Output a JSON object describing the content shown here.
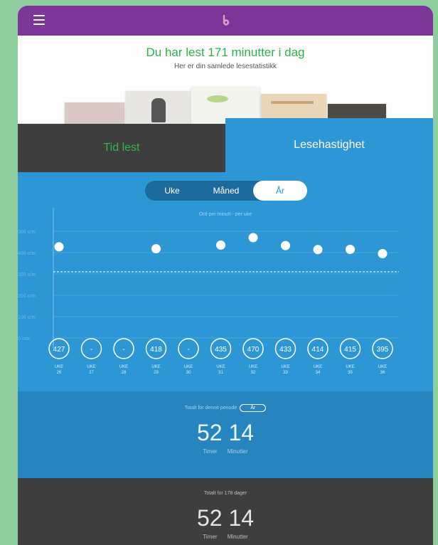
{
  "header": {
    "menu_icon": "hamburger-icon",
    "logo_icon": "bookbites-logo-icon"
  },
  "hero": {
    "title": "Du har lest 171 minutter i dag",
    "subtitle": "Her er din samlede lesestatistikk"
  },
  "tabs": [
    {
      "label": "Tid lest",
      "active": false
    },
    {
      "label": "Lesehastighet",
      "active": true
    }
  ],
  "segmented": {
    "options": [
      "Uke",
      "Måned",
      "År"
    ],
    "selected": "År"
  },
  "chart_data": {
    "type": "scatter",
    "title": "Ord per minutt - per uke",
    "y_ticks": [
      "500 o/m",
      "400 o/m",
      "300 o/m",
      "200 o/m",
      "100 o/m",
      "0 o/m"
    ],
    "ylim": [
      0,
      500
    ],
    "reference_line": 310,
    "categories": [
      "UKE 26",
      "UKE 27",
      "UKE 28",
      "UKE 29",
      "UKE 30",
      "UKE 31",
      "UKE 32",
      "UKE 33",
      "UKE 34",
      "UKE 35",
      "UKE 36"
    ],
    "values": [
      427,
      null,
      null,
      418,
      null,
      435,
      470,
      433,
      414,
      415,
      395
    ],
    "value_labels": [
      "427",
      "-",
      "-",
      "418",
      "-",
      "435",
      "470",
      "433",
      "414",
      "415",
      "395"
    ]
  },
  "period_totals": {
    "label": "Totalt for denne periode",
    "period": "År",
    "hours": "52",
    "minutes": "14",
    "hours_label": "Timer",
    "minutes_label": "Minutter"
  },
  "all_totals": {
    "label": "Totalt for 178 dager",
    "hours": "52",
    "minutes": "14",
    "hours_label": "Timer",
    "minutes_label": "Minutter"
  },
  "colors": {
    "header": "#7b3697",
    "accent_green": "#2db34a",
    "chart_bg": "#2d97d6",
    "dark": "#3e3e3e"
  }
}
